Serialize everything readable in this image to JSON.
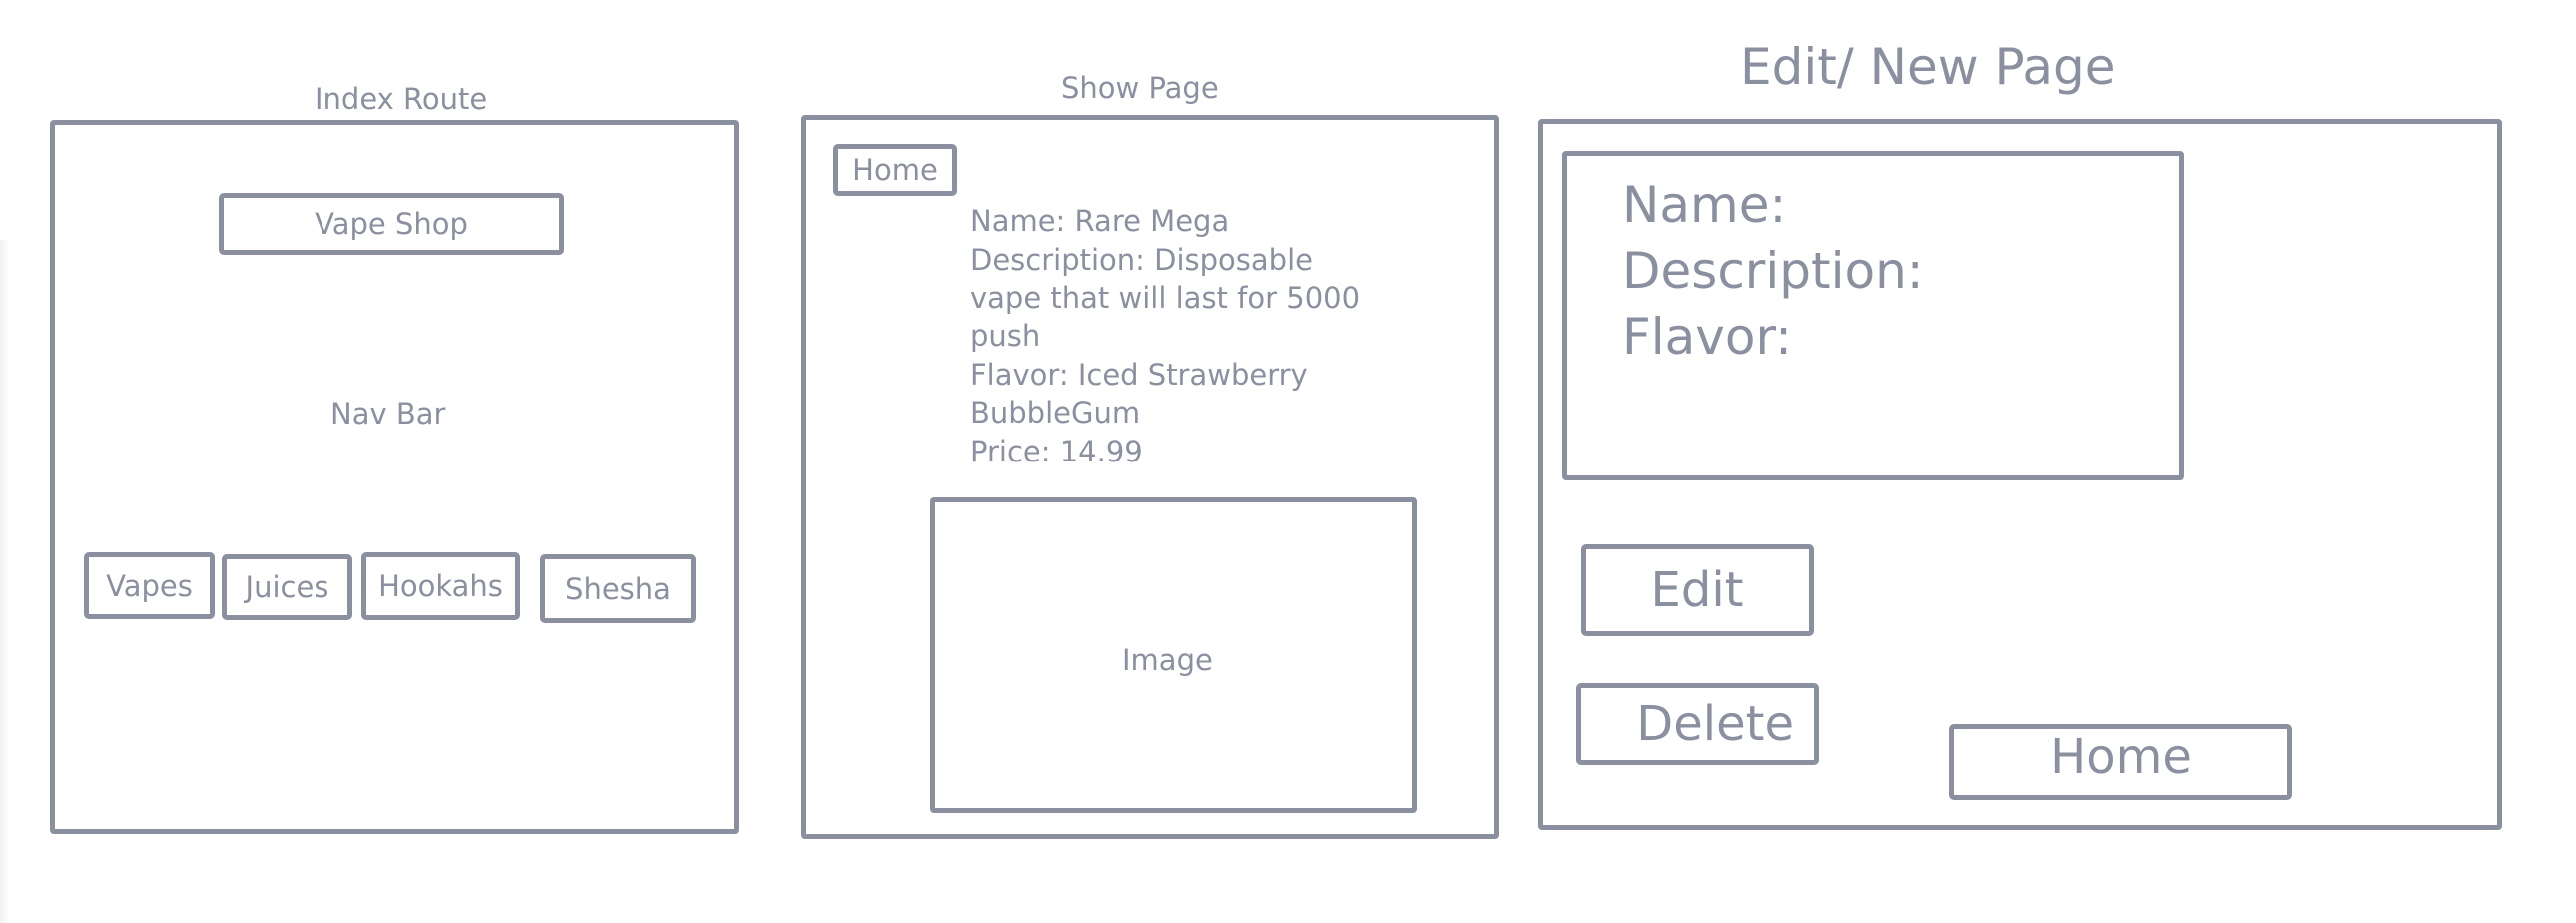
{
  "index_route": {
    "title": "Index Route",
    "brand_button": "Vape Shop",
    "nav_label": "Nav Bar",
    "nav_items": [
      {
        "label": "Vapes"
      },
      {
        "label": "Juices"
      },
      {
        "label": "Hookahs"
      },
      {
        "label": "Shesha"
      }
    ]
  },
  "show_page": {
    "title": "Show Page",
    "home_button": "Home",
    "details": [
      "Name: Rare Mega",
      "Description: Disposable",
      "vape that will last for 5000",
      "push",
      "Flavor: Iced Strawberry",
      "BubbleGum",
      "Price: 14.99"
    ],
    "image_label": "Image"
  },
  "edit_page": {
    "title": "Edit/ New Page",
    "form_fields": [
      "Name:",
      "Description:",
      "Flavor:"
    ],
    "edit_button": "Edit",
    "delete_button": "Delete",
    "home_button": "Home"
  },
  "colors": {
    "stroke": "#8b90a0",
    "background": "#ffffff"
  }
}
